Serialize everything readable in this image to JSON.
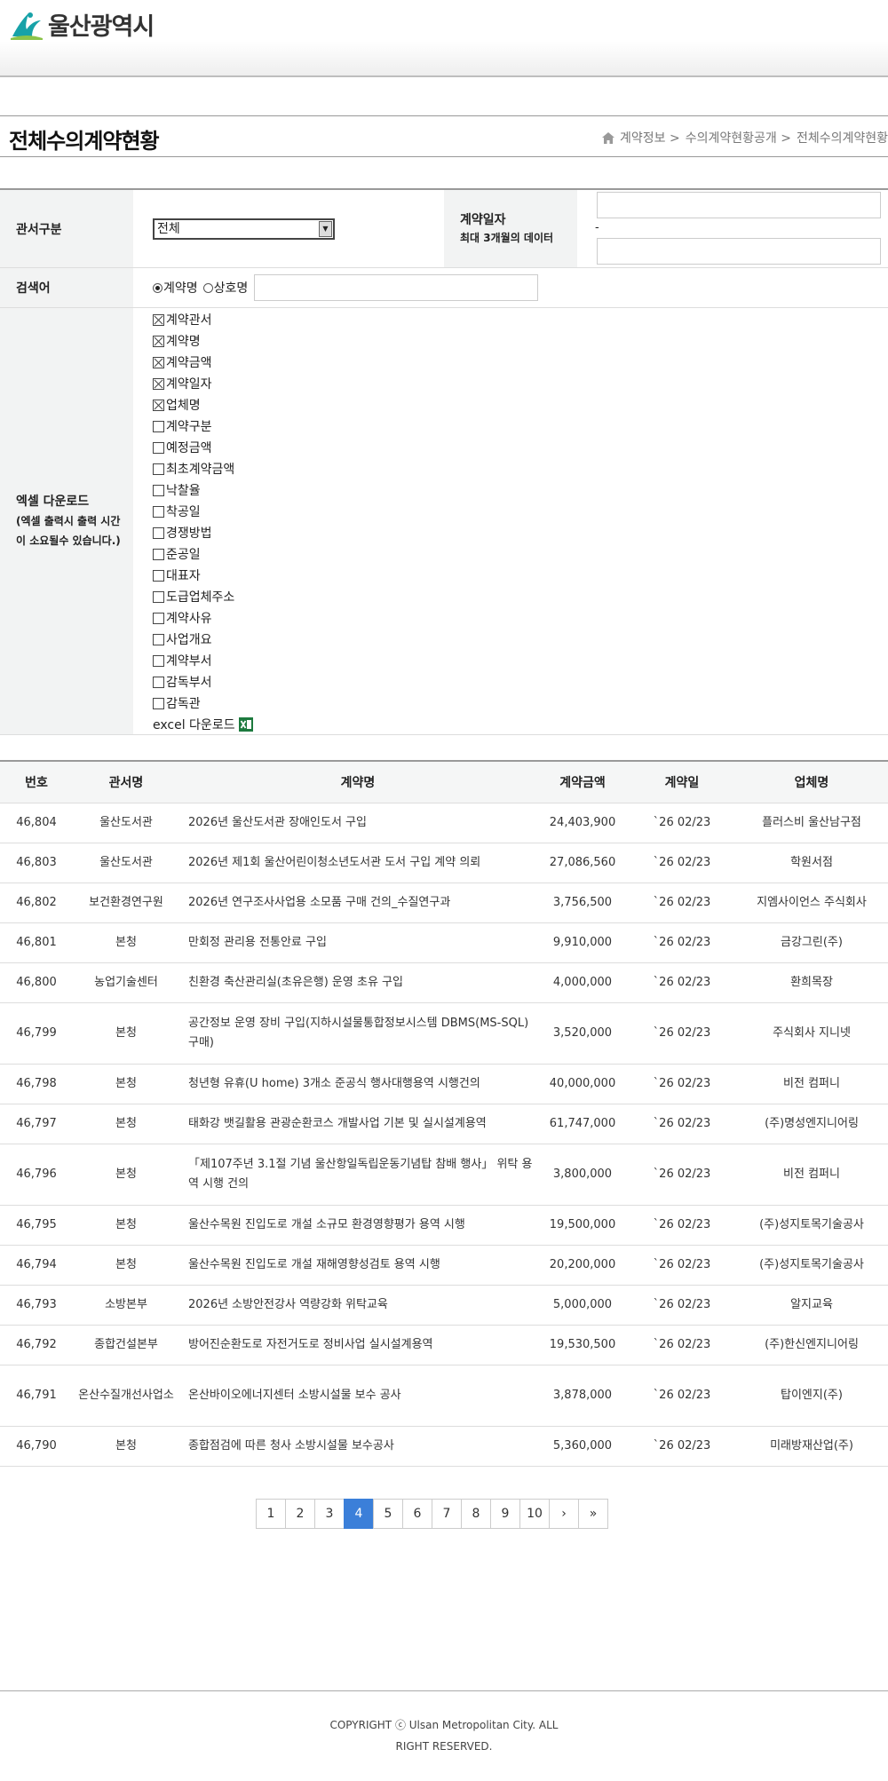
{
  "header": {
    "logo_text": "울산광역시"
  },
  "page": {
    "title": "전체수의계약현황",
    "breadcrumb": [
      "계약정보 >",
      "수의계약현황공개 >",
      "전체수의계약현황"
    ]
  },
  "search": {
    "agency_label": "관서구분",
    "agency_value": "전체",
    "date_label": "계약일자",
    "date_note": "최대 3개월의 데이터",
    "date_sep": "-",
    "keyword_label": "검색어",
    "radio_contract": "계약명",
    "radio_company": "상호명",
    "excel_label": "엑셀 다운로드",
    "excel_note": "(엑셀 출력시 출력 시간이 소요될수 있습니다.)",
    "excel_button": "excel 다운로드",
    "columns": [
      {
        "label": "계약관서",
        "checked": true
      },
      {
        "label": "계약명",
        "checked": true
      },
      {
        "label": "계약금액",
        "checked": true
      },
      {
        "label": "계약일자",
        "checked": true
      },
      {
        "label": "업체명",
        "checked": true
      },
      {
        "label": "계약구분",
        "checked": false
      },
      {
        "label": "예정금액",
        "checked": false
      },
      {
        "label": "최초계약금액",
        "checked": false
      },
      {
        "label": "낙찰율",
        "checked": false
      },
      {
        "label": "착공일",
        "checked": false
      },
      {
        "label": "경쟁방법",
        "checked": false
      },
      {
        "label": "준공일",
        "checked": false
      },
      {
        "label": "대표자",
        "checked": false
      },
      {
        "label": "도급업체주소",
        "checked": false
      },
      {
        "label": "계약사유",
        "checked": false
      },
      {
        "label": "사업개요",
        "checked": false
      },
      {
        "label": "계약부서",
        "checked": false
      },
      {
        "label": "감독부서",
        "checked": false
      },
      {
        "label": "감독관",
        "checked": false
      }
    ]
  },
  "table": {
    "headers": [
      "번호",
      "관서명",
      "계약명",
      "계약금액",
      "계약일",
      "업체명"
    ],
    "rows": [
      [
        "46,804",
        "울산도서관",
        "2026년 울산도서관 장애인도서 구입",
        "24,403,900",
        "`26 02/23",
        "플러스비 울산남구점"
      ],
      [
        "46,803",
        "울산도서관",
        "2026년 제1회 울산어린이청소년도서관 도서 구입 계약 의뢰",
        "27,086,560",
        "`26 02/23",
        "학원서점"
      ],
      [
        "46,802",
        "보건환경연구원",
        "2026년 연구조사사업용 소모품 구매 건의_수질연구과",
        "3,756,500",
        "`26 02/23",
        "지엠사이언스 주식회사"
      ],
      [
        "46,801",
        "본청",
        "만회정 관리용 전통안료 구입",
        "9,910,000",
        "`26 02/23",
        "금강그린(주)"
      ],
      [
        "46,800",
        "농업기술센터",
        "친환경 축산관리실(초유은행) 운영 초유 구입",
        "4,000,000",
        "`26 02/23",
        "환희목장"
      ],
      [
        "46,799",
        "본청",
        "공간정보 운영 장비 구입(지하시설물통합정보시스템 DBMS(MS-SQL) 구매)",
        "3,520,000",
        "`26 02/23",
        "주식회사 지니넷"
      ],
      [
        "46,798",
        "본청",
        "청년형 유휴(U home) 3개소 준공식 행사대행용역 시행건의",
        "40,000,000",
        "`26 02/23",
        "비전 컴퍼니"
      ],
      [
        "46,797",
        "본청",
        "태화강 뱃길활용 관광순환코스 개발사업 기본 및 실시설계용역",
        "61,747,000",
        "`26 02/23",
        "(주)명성엔지니어링"
      ],
      [
        "46,796",
        "본청",
        "「제107주년 3.1절 기념 울산항일독립운동기념탑 참배 행사」 위탁 용역 시행 건의",
        "3,800,000",
        "`26 02/23",
        "비전 컴퍼니"
      ],
      [
        "46,795",
        "본청",
        "울산수목원 진입도로 개설 소규모 환경영향평가 용역 시행",
        "19,500,000",
        "`26 02/23",
        "(주)성지토목기술공사"
      ],
      [
        "46,794",
        "본청",
        "울산수목원 진입도로 개설 재해영향성검토 용역 시행",
        "20,200,000",
        "`26 02/23",
        "(주)성지토목기술공사"
      ],
      [
        "46,793",
        "소방본부",
        "2026년 소방안전강사 역량강화 위탁교육",
        "5,000,000",
        "`26 02/23",
        "알지교육"
      ],
      [
        "46,792",
        "종합건설본부",
        "방어진순환도로 자전거도로 정비사업 실시설계용역",
        "19,530,500",
        "`26 02/23",
        "(주)한신엔지니어링"
      ],
      [
        "46,791",
        "온산수질개선사업소",
        "온산바이오에너지센터 소방시설물 보수 공사",
        "3,878,000",
        "`26 02/23",
        "탑이엔지(주)"
      ],
      [
        "46,790",
        "본청",
        "종합점검에 따른 청사 소방시설물 보수공사",
        "5,360,000",
        "`26 02/23",
        "미래방재산업(주)"
      ]
    ]
  },
  "paging": {
    "pages": [
      "1",
      "2",
      "3",
      "4",
      "5",
      "6",
      "7",
      "8",
      "9",
      "10",
      "›",
      "»"
    ],
    "current": "4"
  },
  "footer": {
    "copyright": "COPYRIGHT ⓒ Ulsan Metropolitan City. ALL RIGHT RESERVED."
  },
  "colors": {
    "accent": "#3b7fd9",
    "label_bg": "#f2f3f3",
    "logo_teal": "#17a2a8",
    "logo_green": "#8bc34a"
  }
}
